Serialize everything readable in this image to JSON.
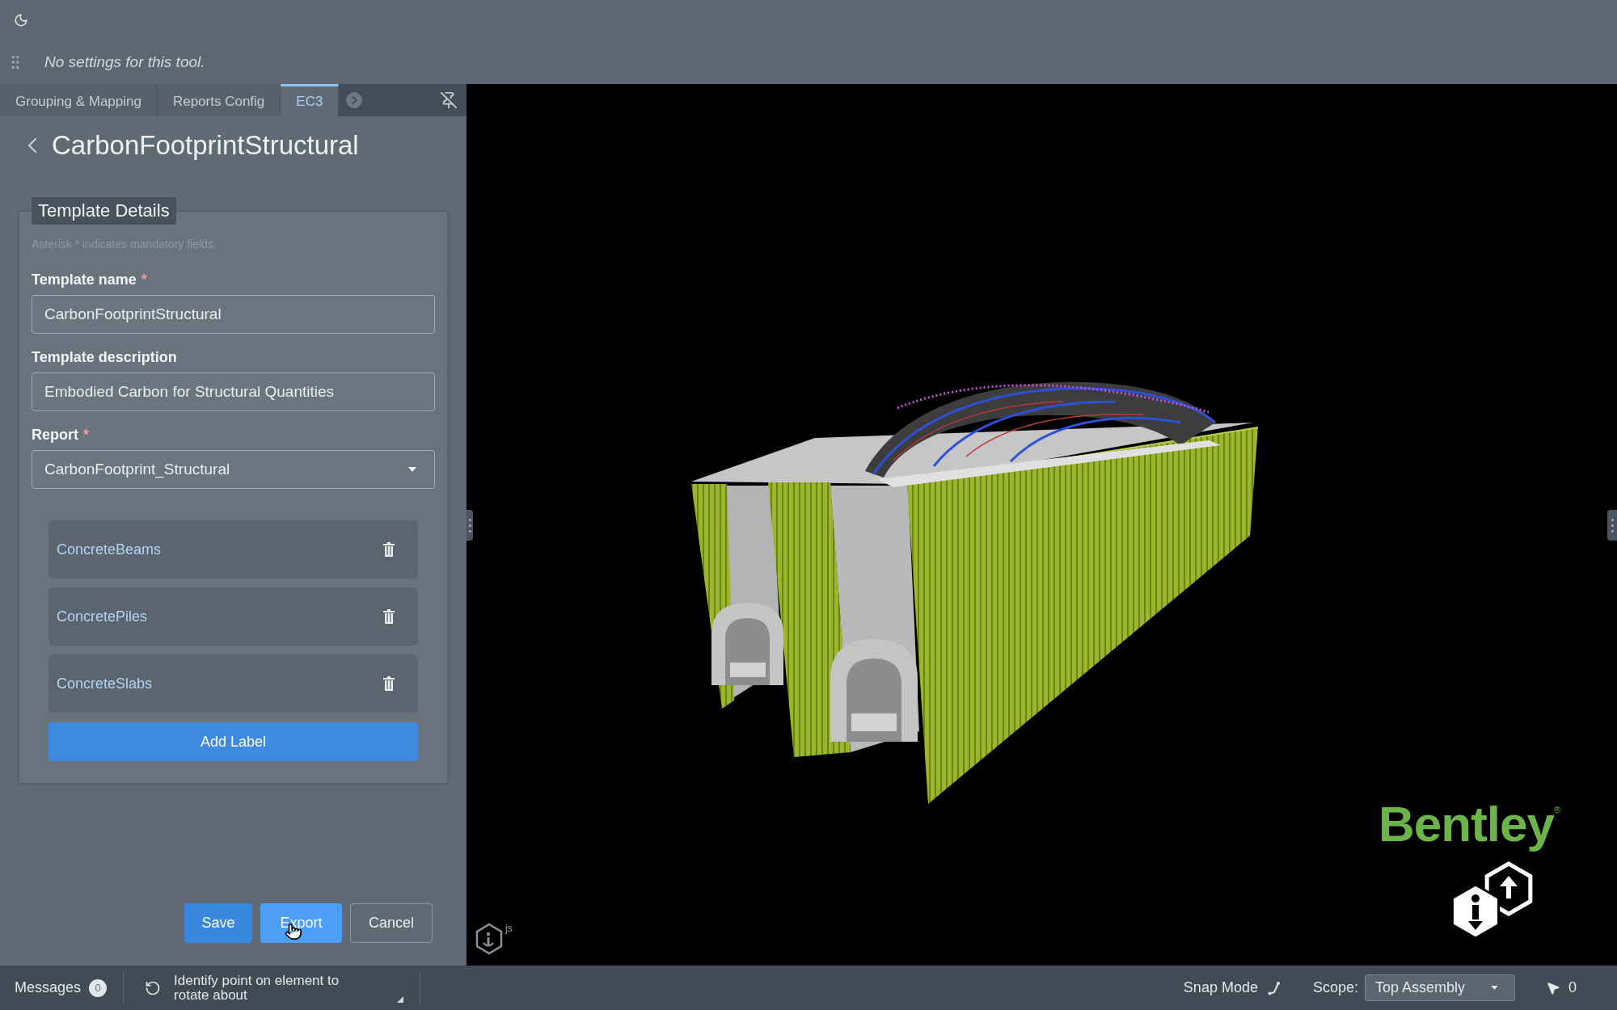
{
  "toolbar": {
    "message": "No settings for this tool."
  },
  "tabs": [
    {
      "label": "Grouping & Mapping",
      "selected": false
    },
    {
      "label": "Reports Config",
      "selected": false
    },
    {
      "label": "EC3",
      "selected": true
    }
  ],
  "panel": {
    "title": "CarbonFootprintStructural"
  },
  "form": {
    "legend": "Template Details",
    "note": "Asterisk * indicates mandatory fields.",
    "fields": [
      {
        "kind": "text",
        "label": "Template name",
        "required_mark": "*",
        "value": "CarbonFootprintStructural"
      },
      {
        "kind": "text",
        "label": "Template description",
        "value": "Embodied Carbon for Structural Quantities"
      },
      {
        "kind": "select",
        "label": "Report",
        "required_mark": "*",
        "value": "CarbonFootprint_Structural"
      }
    ],
    "labels": [
      "ConcreteBeams",
      "ConcretePiles",
      "ConcreteSlabs"
    ],
    "add_button": "Add Label"
  },
  "actions": [
    {
      "label": "Save",
      "kind": "primary",
      "hovered": false
    },
    {
      "label": "Export",
      "kind": "primary",
      "hovered": true
    },
    {
      "label": "Cancel",
      "kind": "secondary",
      "hovered": false
    }
  ],
  "viewport": {
    "logo": {
      "text": "Bentley",
      "mark": "®"
    },
    "badge": {
      "text": "js"
    }
  },
  "status_bar": {
    "messages": {
      "label": "Messages",
      "count": "0"
    },
    "prompt": "Identify point on element to rotate about",
    "snap_mode": "Snap Mode",
    "scope": {
      "label": "Scope:",
      "value": "Top Assembly"
    },
    "selection_count": "0"
  }
}
